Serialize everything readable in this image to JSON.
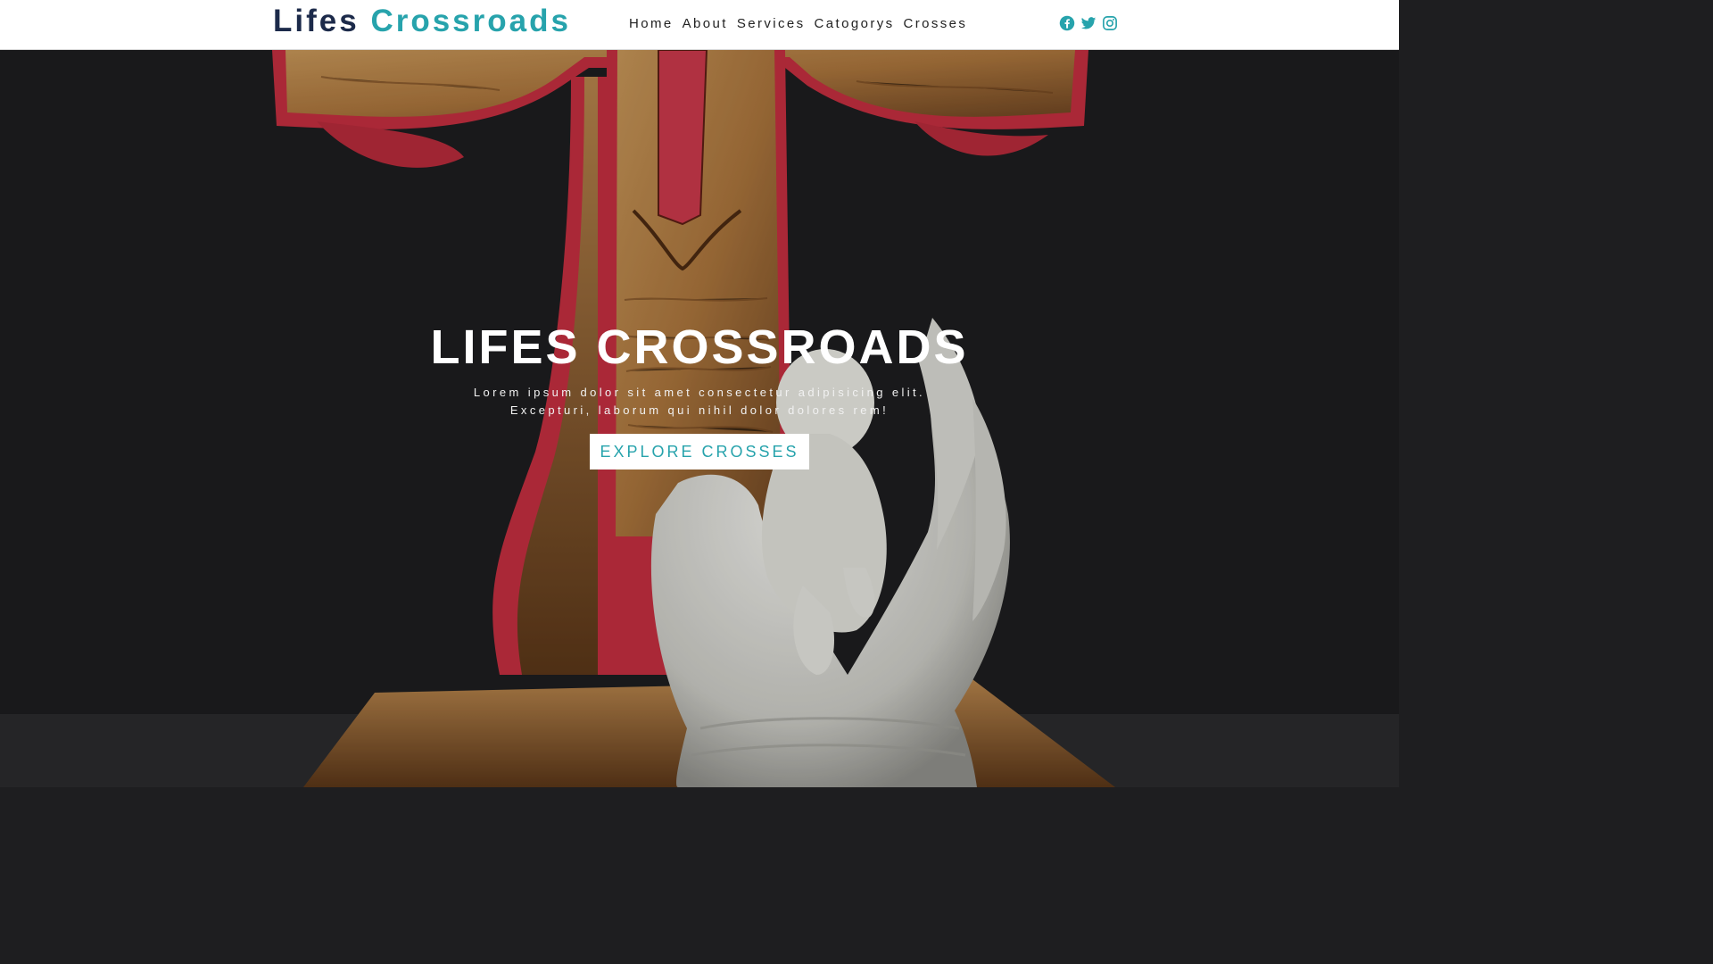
{
  "header": {
    "brand_part1": "Lifes",
    "brand_part2": "Crossroads",
    "nav": [
      "Home",
      "About",
      "Services",
      "Catogorys",
      "Crosses"
    ],
    "social": [
      "facebook-icon",
      "twitter-icon",
      "instagram-icon"
    ]
  },
  "hero": {
    "title": "LIFES CROSSROADS",
    "subtitle_line1": "Lorem ipsum dolor sit amet consectetur adipisicing elit.",
    "subtitle_line2": "Excepturi, laborum qui nihil dolor dolores rem!",
    "button_label": "EXPLORE CROSSES"
  },
  "colors": {
    "brand_dark": "#1c2a4a",
    "accent": "#27a3ac",
    "header_bg": "#ffffff",
    "hero_bg": "#1c1c1e"
  }
}
